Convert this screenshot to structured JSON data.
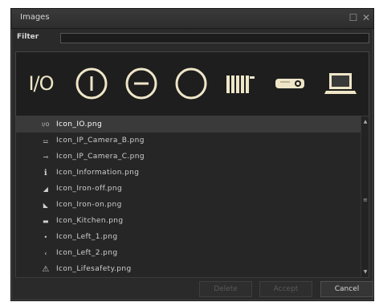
{
  "window": {
    "title": "Images",
    "maximize_glyph": "☐",
    "close_glyph": "✕"
  },
  "filter": {
    "label": "Filter",
    "value": ""
  },
  "preview_icons": [
    {
      "name": "io-text-icon",
      "text": "I/O"
    },
    {
      "name": "power-on-icon"
    },
    {
      "name": "power-minus-icon"
    },
    {
      "name": "power-off-circle-icon"
    },
    {
      "name": "radiator-icon"
    },
    {
      "name": "projector-icon"
    },
    {
      "name": "laptop-icon"
    }
  ],
  "files": [
    {
      "name": "Icon_IO.png",
      "icon": "I/O",
      "icon_name": "io-icon",
      "selected": true
    },
    {
      "name": "Icon_IP_Camera_B.png",
      "icon": "⚍",
      "icon_name": "ip-camera-icon"
    },
    {
      "name": "Icon_IP_Camera_C.png",
      "icon": "⊸",
      "icon_name": "ip-camera-icon"
    },
    {
      "name": "Icon_Information.png",
      "icon": "ℹ",
      "icon_name": "information-icon"
    },
    {
      "name": "Icon_Iron-off.png",
      "icon": "◢",
      "icon_name": "iron-icon"
    },
    {
      "name": "Icon_Iron-on.png",
      "icon": "◣",
      "icon_name": "iron-icon"
    },
    {
      "name": "Icon_Kitchen.png",
      "icon": "▬",
      "icon_name": "kitchen-icon"
    },
    {
      "name": "Icon_Left_1.png",
      "icon": "•",
      "icon_name": "left-arrow-icon"
    },
    {
      "name": "Icon_Left_2.png",
      "icon": "‹",
      "icon_name": "left-arrow-icon"
    },
    {
      "name": "Icon_Lifesafety.png",
      "icon": "⚠",
      "icon_name": "warning-icon"
    }
  ],
  "scroll": {
    "up": "▲",
    "down": "▼",
    "thumb": "≡"
  },
  "buttons": {
    "delete": "Delete",
    "accept": "Accept",
    "cancel": "Cancel"
  },
  "colors": {
    "dialog_bg": "#2a2a2a",
    "selected_row": "#3a3a3a",
    "icon_cream": "#efe6c8"
  }
}
